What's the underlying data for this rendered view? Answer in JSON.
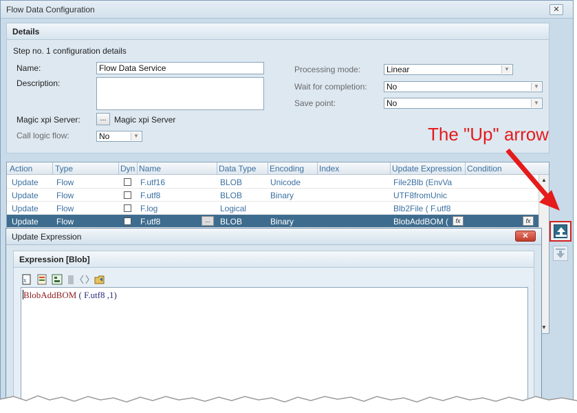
{
  "window": {
    "title": "Flow Data Configuration",
    "close_glyph": "✕"
  },
  "details": {
    "title": "Details",
    "step_text": "Step no. 1 configuration details",
    "name_label": "Name:",
    "name_value": "Flow Data Service",
    "description_label": "Description:",
    "description_value": "",
    "server_label": "Magic xpi Server:",
    "server_button": "...",
    "server_value": "Magic xpi Server",
    "call_logic_label": "Call logic flow:",
    "call_logic_value": "No",
    "processing_mode_label": "Processing mode:",
    "processing_mode_value": "Linear",
    "wait_label": "Wait for completion:",
    "wait_value": "No",
    "save_point_label": "Save point:",
    "save_point_value": "No"
  },
  "grid": {
    "columns": [
      "Action",
      "Type",
      "Dyn",
      "Name",
      "Data Type",
      "Encoding",
      "Index",
      "Update Expression",
      "Condition"
    ],
    "rows": [
      {
        "action": "Update",
        "type": "Flow",
        "name": "F.utf16",
        "data_type": "BLOB",
        "encoding": "Unicode",
        "update_expression": "File2Blb (EnvVa",
        "selected": false
      },
      {
        "action": "Update",
        "type": "Flow",
        "name": "F.utf8",
        "data_type": "BLOB",
        "encoding": "Binary",
        "update_expression": "UTF8fromUnic",
        "selected": false
      },
      {
        "action": "Update",
        "type": "Flow",
        "name": "F.log",
        "data_type": "Logical",
        "encoding": "",
        "update_expression": "Blb2File ( F.utf8",
        "selected": false
      },
      {
        "action": "Update",
        "type": "Flow",
        "name": "F.utf8",
        "data_type": "BLOB",
        "encoding": "Binary",
        "update_expression": "BlobAddBOM (",
        "selected": true
      }
    ],
    "fx_label": "fx",
    "row_dots": "..."
  },
  "annotation": {
    "text": "The \"Up\" arrow",
    "color": "#e51b1b"
  },
  "dialog": {
    "title": "Update Expression",
    "close_glyph": "✕",
    "panel_title": "Expression [Blob]",
    "expression_func": "BlobAddBOM",
    "expression_args": " ( F.utf8 ,1)"
  },
  "icons": [
    "expression-new-icon",
    "functions-icon",
    "variables-icon",
    "delete-icon",
    "brackets-icon",
    "open-icon"
  ],
  "colors": {
    "accent": "#3e6c8e",
    "annotation": "#e51b1b",
    "link_text": "#3a6fa0"
  }
}
